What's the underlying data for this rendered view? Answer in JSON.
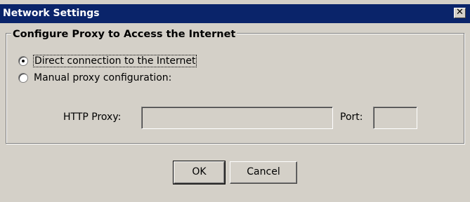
{
  "window": {
    "title": "Network Settings",
    "close_symbol": "✕"
  },
  "group": {
    "title": "Configure Proxy to Access the Internet"
  },
  "options": [
    {
      "label": "Direct connection to the Internet",
      "checked": true
    },
    {
      "label": "Manual proxy configuration:",
      "checked": false
    }
  ],
  "http_proxy": {
    "label": "HTTP Proxy:",
    "value": ""
  },
  "port": {
    "label": "Port:",
    "value": ""
  },
  "buttons": {
    "ok": "OK",
    "cancel": "Cancel"
  },
  "icons": {
    "close": "close-icon"
  },
  "colors": {
    "titlebar": "#0a246a",
    "dialog_bg": "#d4d0c8"
  }
}
